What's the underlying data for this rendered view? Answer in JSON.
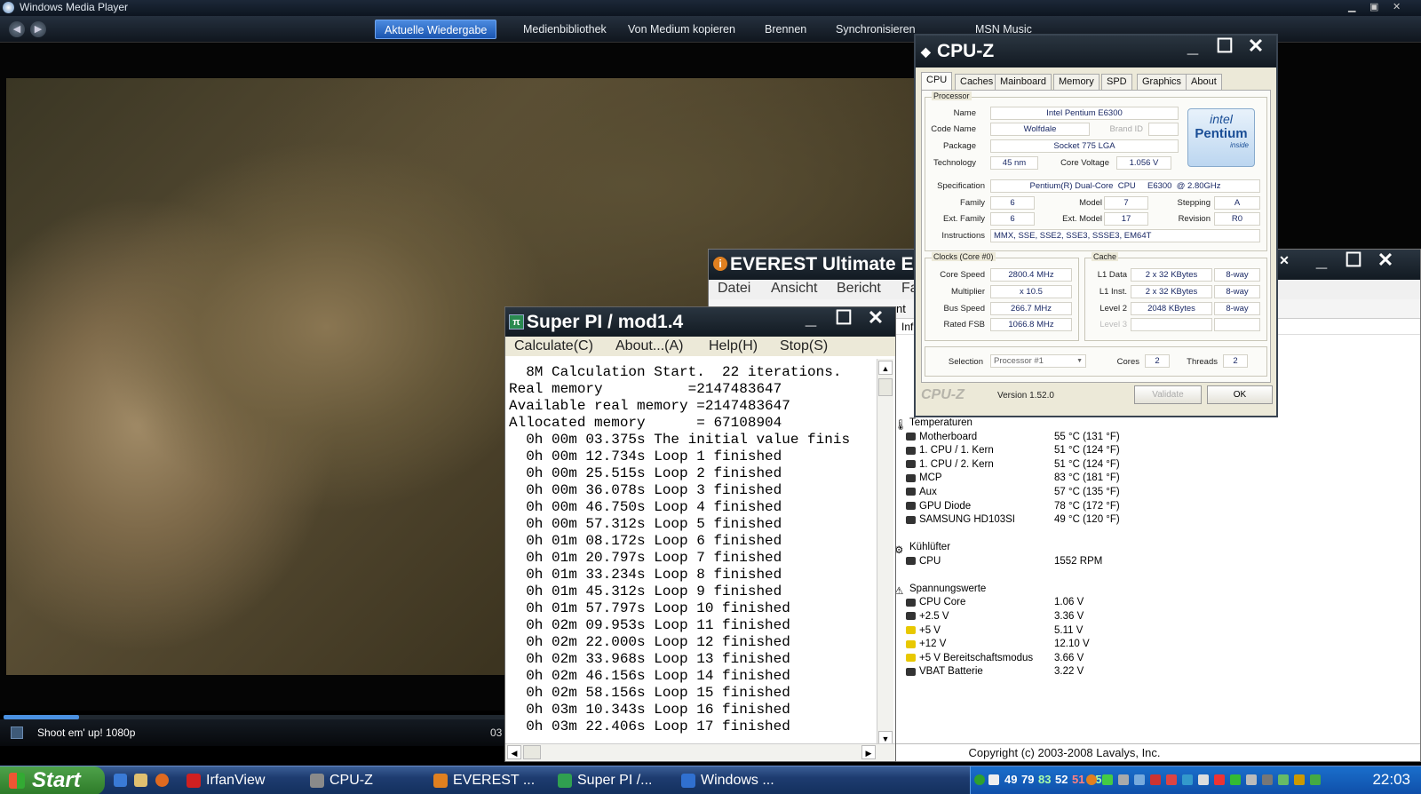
{
  "wmp": {
    "title": "Windows Media Player",
    "tabs": [
      "Aktuelle Wiedergabe",
      "Medienbibliothek",
      "Von Medium kopieren",
      "Brennen",
      "Synchronisieren",
      "MSN Music"
    ],
    "now_playing": "Shoot em' up! 1080p",
    "time": "03",
    "seek_progress": 0.08
  },
  "cpuz": {
    "title": "CPU-Z",
    "tabs": [
      "CPU",
      "Caches",
      "Mainboard",
      "Memory",
      "SPD",
      "Graphics",
      "About"
    ],
    "processor_label": "Processor",
    "name_label": "Name",
    "name": "Intel Pentium E6300",
    "codename_label": "Code Name",
    "codename": "Wolfdale",
    "brandid_label": "Brand ID",
    "package_label": "Package",
    "package": "Socket 775 LGA",
    "tech_label": "Technology",
    "tech": "45 nm",
    "voltage_label": "Core Voltage",
    "voltage": "1.056 V",
    "spec_label": "Specification",
    "spec": "Pentium(R) Dual-Core  CPU     E6300  @ 2.80GHz",
    "family_label": "Family",
    "family": "6",
    "model_label": "Model",
    "model": "7",
    "stepping_label": "Stepping",
    "stepping": "A",
    "extfamily_label": "Ext. Family",
    "extfamily": "6",
    "extmodel_label": "Ext. Model",
    "extmodel": "17",
    "revision_label": "Revision",
    "revision": "R0",
    "instr_label": "Instructions",
    "instr": "MMX, SSE, SSE2, SSE3, SSSE3, EM64T",
    "clocks_label": "Clocks (Core #0)",
    "corespeed_label": "Core Speed",
    "corespeed": "2800.4 MHz",
    "multiplier_label": "Multiplier",
    "multiplier": "x 10.5",
    "busspeed_label": "Bus Speed",
    "busspeed": "266.7 MHz",
    "fsb_label": "Rated FSB",
    "fsb": "1066.8 MHz",
    "cache_label": "Cache",
    "l1d_label": "L1 Data",
    "l1d": "2 x 32 KBytes",
    "l1d_way": "8-way",
    "l1i_label": "L1 Inst.",
    "l1i": "2 x 32 KBytes",
    "l1i_way": "8-way",
    "l2_label": "Level 2",
    "l2": "2048 KBytes",
    "l2_way": "8-way",
    "l3_label": "Level 3",
    "selection_label": "Selection",
    "selection": "Processor #1",
    "cores_label": "Cores",
    "cores": "2",
    "threads_label": "Threads",
    "threads": "2",
    "brand": "CPU-Z",
    "version": "Version 1.52.0",
    "validate": "Validate",
    "ok": "OK",
    "logo_top": "intel",
    "logo_main": "Pentium",
    "logo_sub": "inside"
  },
  "everest": {
    "title": "EVEREST Ultimate Ec",
    "menu": [
      "Datei",
      "Ansicht",
      "Bericht",
      "Fa"
    ],
    "frag1": "nt",
    "frag2": "Inf",
    "temp_header": "Temperaturen",
    "temps": [
      {
        "name": "Motherboard",
        "value": "55 °C  (131 °F)"
      },
      {
        "name": "1. CPU / 1. Kern",
        "value": "51 °C  (124 °F)"
      },
      {
        "name": "1. CPU / 2. Kern",
        "value": "51 °C  (124 °F)"
      },
      {
        "name": "MCP",
        "value": "83 °C  (181 °F)"
      },
      {
        "name": "Aux",
        "value": "57 °C  (135 °F)"
      },
      {
        "name": "GPU Diode",
        "value": "78 °C  (172 °F)"
      },
      {
        "name": "SAMSUNG HD103SI",
        "value": "49 °C  (120 °F)"
      }
    ],
    "fan_header": "Kühlüfter",
    "fans": [
      {
        "name": "CPU",
        "value": "1552 RPM"
      }
    ],
    "volt_header": "Spannungswerte",
    "volts": [
      {
        "name": "CPU Core",
        "value": "1.06 V"
      },
      {
        "name": "+2.5 V",
        "value": "3.36 V"
      },
      {
        "name": "+5 V",
        "value": "5.11 V"
      },
      {
        "name": "+12 V",
        "value": "12.10 V"
      },
      {
        "name": "+5 V Bereitschaftsmodus",
        "value": "3.66 V"
      },
      {
        "name": "VBAT Batterie",
        "value": "3.22 V"
      }
    ],
    "copyright": "Copyright (c) 2003-2008 Lavalys, Inc."
  },
  "superpi": {
    "title": "Super PI / mod1.4",
    "menu": [
      "Calculate(C)",
      "About...(A)",
      "Help(H)",
      "Stop(S)"
    ],
    "lines": [
      "  8M Calculation Start.  22 iterations.",
      "Real memory          =2147483647",
      "Available real memory =2147483647",
      "Allocated memory      = 67108904",
      "  0h 00m 03.375s The initial value finis",
      "  0h 00m 12.734s Loop 1 finished",
      "  0h 00m 25.515s Loop 2 finished",
      "  0h 00m 36.078s Loop 3 finished",
      "  0h 00m 46.750s Loop 4 finished",
      "  0h 00m 57.312s Loop 5 finished",
      "  0h 01m 08.172s Loop 6 finished",
      "  0h 01m 20.797s Loop 7 finished",
      "  0h 01m 33.234s Loop 8 finished",
      "  0h 01m 45.312s Loop 9 finished",
      "  0h 01m 57.797s Loop 10 finished",
      "  0h 02m 09.953s Loop 11 finished",
      "  0h 02m 22.000s Loop 12 finished",
      "  0h 02m 33.968s Loop 13 finished",
      "  0h 02m 46.156s Loop 14 finished",
      "  0h 02m 58.156s Loop 15 finished",
      "  0h 03m 10.343s Loop 16 finished",
      "  0h 03m 22.406s Loop 17 finished"
    ]
  },
  "taskbar": {
    "start": "Start",
    "items": [
      {
        "label": "IrfanView",
        "color": "#d02020"
      },
      {
        "label": "CPU-Z",
        "color": "#8a8a8a"
      },
      {
        "label": "EVEREST ...",
        "color": "#e08020"
      },
      {
        "label": "Super PI /...",
        "color": "#30a050"
      },
      {
        "label": "Windows ...",
        "color": "#3070d0"
      }
    ],
    "tray_numbers": [
      {
        "v": "49",
        "c": "#ffffff"
      },
      {
        "v": "79",
        "c": "#ffffff"
      },
      {
        "v": "83",
        "c": "#aaffaa"
      },
      {
        "v": "52",
        "c": "#ffffff"
      },
      {
        "v": "51",
        "c": "#ff8080"
      },
      {
        "v": "55",
        "c": "#aaffaa"
      }
    ],
    "clock": "22:03"
  }
}
